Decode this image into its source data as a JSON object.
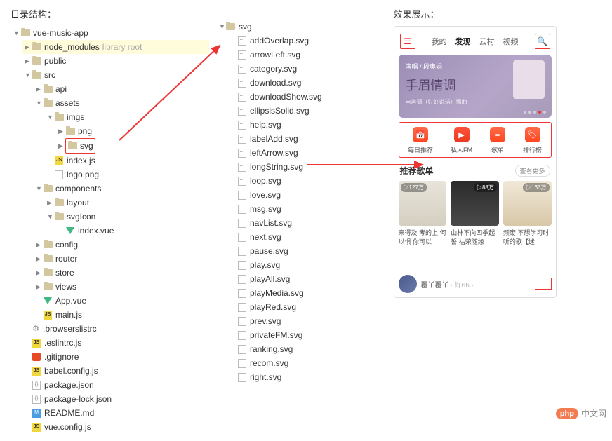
{
  "headings": {
    "structure": "目录结构：",
    "preview": "效果展示："
  },
  "tree_left": {
    "root": "vue-music-app",
    "node_modules": "node_modules",
    "library_root": "library root",
    "public": "public",
    "src": "src",
    "api": "api",
    "assets": "assets",
    "imgs": "imgs",
    "png": "png",
    "svg": "svg",
    "index_js": "index.js",
    "logo_png": "logo.png",
    "components": "components",
    "layout": "layout",
    "svgIcon": "svgIcon",
    "index_vue": "index.vue",
    "config": "config",
    "router": "router",
    "store": "store",
    "views": "views",
    "app_vue": "App.vue",
    "main_js": "main.js",
    "browserslistrc": ".browserslistrc",
    "eslintrc": ".eslintrc.js",
    "gitignore": ".gitignore",
    "babel": "babel.config.js",
    "package_json": "package.json",
    "package_lock": "package-lock.json",
    "readme": "README.md",
    "vue_config": "vue.config.js"
  },
  "tree_svg": {
    "root": "svg",
    "files": [
      "addOverlap.svg",
      "arrowLeft.svg",
      "category.svg",
      "download.svg",
      "downloadShow.svg",
      "ellipsisSolid.svg",
      "help.svg",
      "labelAdd.svg",
      "leftArrow.svg",
      "longString.svg",
      "loop.svg",
      "love.svg",
      "msg.svg",
      "navList.svg",
      "next.svg",
      "pause.svg",
      "play.svg",
      "playAll.svg",
      "playMedia.svg",
      "playRed.svg",
      "prev.svg",
      "privateFM.svg",
      "ranking.svg",
      "recom.svg",
      "right.svg"
    ]
  },
  "phone": {
    "tabs": [
      "我的",
      "发现",
      "云村",
      "视频"
    ],
    "banner_top": "演唱 / 段奥娟",
    "banner_script": "手眉情调",
    "banner_sub": "电声调（好好说话）插曲",
    "icons": [
      {
        "label": "每日推荐",
        "glyph": "📅"
      },
      {
        "label": "私人FM",
        "glyph": "▶"
      },
      {
        "label": "歌单",
        "glyph": "≡"
      },
      {
        "label": "排行榜",
        "glyph": "🏷"
      }
    ],
    "rec_title": "推荐歌单",
    "rec_more": "查看更多",
    "cards": [
      {
        "badge": "▷127万",
        "text": "来得及 考的上 何以惧 你可以"
      },
      {
        "badge": "▷88万",
        "text": "山林不向四季起誓 枯荣随缘"
      },
      {
        "badge": "▷163万",
        "text": "频废 不想学习时听的歌【迷"
      }
    ],
    "user": "覆丫覆丫",
    "user_sub": "· 许66 ·"
  },
  "watermark": {
    "badge": "php",
    "text": "中文网"
  }
}
